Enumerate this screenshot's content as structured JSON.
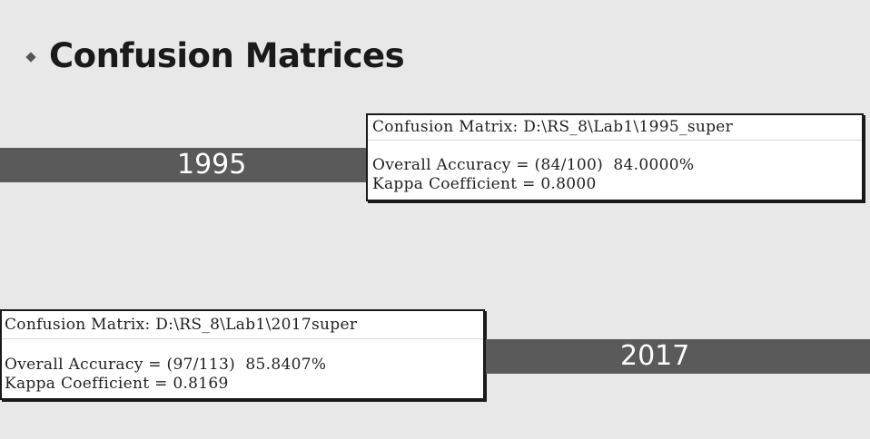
{
  "slide": {
    "title": "Confusion Matrices",
    "bullet_icon": "diamond-bullet-icon"
  },
  "panel_1995": {
    "year_label": "1995",
    "matrix_title": "Confusion Matrix: D:\\RS_8\\Lab1\\1995_super",
    "overall_accuracy": "Overall Accuracy = (84/100)  84.0000%",
    "kappa": "Kappa Coefficient = 0.8000"
  },
  "panel_2017": {
    "year_label": "2017",
    "matrix_title": "Confusion Matrix: D:\\RS_8\\Lab1\\2017super",
    "overall_accuracy": "Overall Accuracy = (97/113)  85.8407%",
    "kappa": "Kappa Coefficient = 0.8169"
  },
  "colors": {
    "background": "#e8e8e8",
    "band": "#5a5a5a",
    "band_text": "#ffffff",
    "box_border": "#1a1a1a",
    "box_bg": "#ffffff"
  }
}
